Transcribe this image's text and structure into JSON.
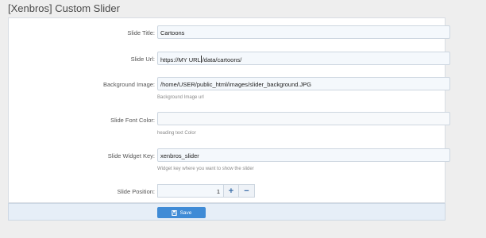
{
  "page": {
    "title": "[Xenbros] Custom Slider"
  },
  "form": {
    "slide_title": {
      "label": "Slide Title:",
      "value": "Cartoons"
    },
    "slide_url": {
      "label": "Slide Url:",
      "value_before_cursor": "https://MY URL",
      "value_after_cursor": "/data/cartoons/"
    },
    "background_image": {
      "label": "Background Image:",
      "value": "/home/USER/public_html/images/slider_background.JPG",
      "hint": "Background Image url"
    },
    "slide_font_color": {
      "label": "Slide Font Color:",
      "value": "",
      "hint": "heading text Color"
    },
    "slide_widget_key": {
      "label": "Slide Widget Key:",
      "value": "xenbros_slider",
      "hint": "Widget key where you want to show the slider"
    },
    "slide_position": {
      "label": "Slide Position:",
      "value": "1",
      "increment_label": "+",
      "decrement_label": "−"
    }
  },
  "footer": {
    "save_label": "Save",
    "save_icon": "floppy-disk-icon"
  },
  "colors": {
    "accent": "#3f8bd6",
    "footer_bg": "#e6eef7",
    "page_bg": "#eeeeee"
  }
}
